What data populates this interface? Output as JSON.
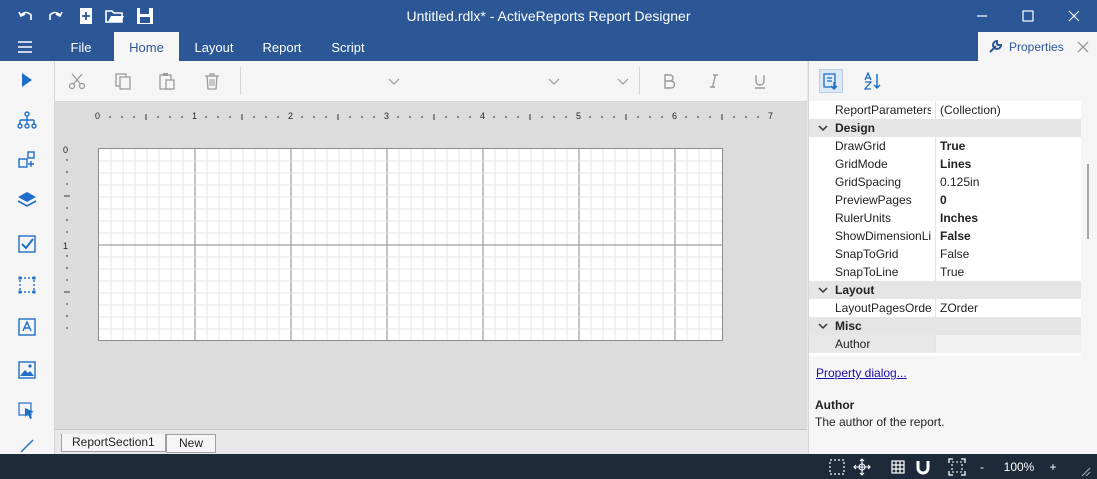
{
  "window": {
    "title": "Untitled.rdlx* - ActiveReports Report Designer"
  },
  "menu": {
    "file": "File",
    "tabs": [
      {
        "label": "Home"
      },
      {
        "label": "Layout"
      },
      {
        "label": "Report"
      },
      {
        "label": "Script"
      }
    ],
    "properties_tab": "Properties"
  },
  "ruler": {
    "h_labels": [
      "0",
      "1",
      "2",
      "3",
      "4",
      "5",
      "6",
      "7"
    ],
    "v_labels": [
      "0",
      "1"
    ]
  },
  "sections": {
    "tabs": [
      {
        "label": "ReportSection1"
      },
      {
        "label": "New"
      }
    ]
  },
  "properties": {
    "rows": [
      {
        "kind": "prop",
        "name": "ReportParameters",
        "value": "(Collection)",
        "bold": false
      },
      {
        "kind": "cat",
        "name": "Design"
      },
      {
        "kind": "prop",
        "name": "DrawGrid",
        "value": "True",
        "bold": true
      },
      {
        "kind": "prop",
        "name": "GridMode",
        "value": "Lines",
        "bold": true
      },
      {
        "kind": "prop",
        "name": "GridSpacing",
        "value": "0.125in",
        "bold": false
      },
      {
        "kind": "prop",
        "name": "PreviewPages",
        "value": "0",
        "bold": true
      },
      {
        "kind": "prop",
        "name": "RulerUnits",
        "value": "Inches",
        "bold": true
      },
      {
        "kind": "prop",
        "name": "ShowDimensionLines",
        "value": "False",
        "bold": true
      },
      {
        "kind": "prop",
        "name": "SnapToGrid",
        "value": "False",
        "bold": false
      },
      {
        "kind": "prop",
        "name": "SnapToLine",
        "value": "True",
        "bold": false
      },
      {
        "kind": "cat",
        "name": "Layout"
      },
      {
        "kind": "prop",
        "name": "LayoutPagesOrder",
        "value": "ZOrder",
        "bold": false
      },
      {
        "kind": "cat",
        "name": "Misc"
      },
      {
        "kind": "prop",
        "name": "Author",
        "value": "",
        "bold": false,
        "selected": true
      }
    ],
    "dialog_link": "Property dialog...",
    "description_title": "Author",
    "description_text": "The author of the report."
  },
  "status": {
    "zoom_minus": "-",
    "zoom": "100%",
    "zoom_plus": "+"
  },
  "colors": {
    "accent": "#2b5797",
    "status_bar": "#1e2a3a"
  }
}
